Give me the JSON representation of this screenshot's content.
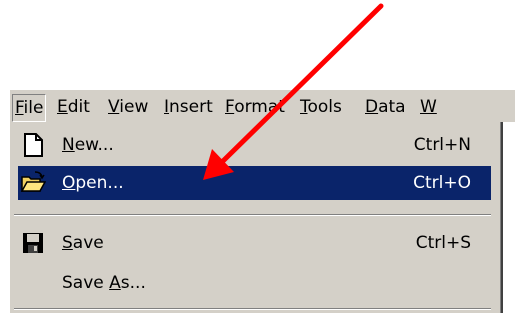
{
  "menubar": {
    "items": [
      {
        "label": "File",
        "underline": "F",
        "rest": "ile"
      },
      {
        "label": "Edit",
        "underline": "E",
        "rest": "dit"
      },
      {
        "label": "View",
        "underline": "V",
        "rest": "iew"
      },
      {
        "label": "Insert",
        "underline": "I",
        "rest": "nsert"
      },
      {
        "label": "Format",
        "underline": "F",
        "rest": "ormat"
      },
      {
        "label": "Tools",
        "underline": "T",
        "rest": "ools"
      },
      {
        "label": "Data",
        "underline": "D",
        "rest": "ata"
      },
      {
        "label": "W",
        "underline": "W",
        "rest": ""
      }
    ]
  },
  "file_menu": {
    "new": {
      "pre": "",
      "u": "N",
      "post": "ew...",
      "shortcut": "Ctrl+N",
      "icon": "new-document-icon"
    },
    "open": {
      "pre": "",
      "u": "O",
      "post": "pen...",
      "shortcut": "Ctrl+O",
      "icon": "open-folder-icon"
    },
    "save": {
      "pre": "",
      "u": "S",
      "post": "ave",
      "shortcut": "Ctrl+S",
      "icon": "floppy-disk-icon"
    },
    "save_as": {
      "pre": "Save ",
      "u": "A",
      "post": "s..."
    }
  },
  "colors": {
    "menu_bg": "#d4d0c8",
    "highlight": "#0a246a",
    "annotation_arrow": "#ff0000"
  }
}
